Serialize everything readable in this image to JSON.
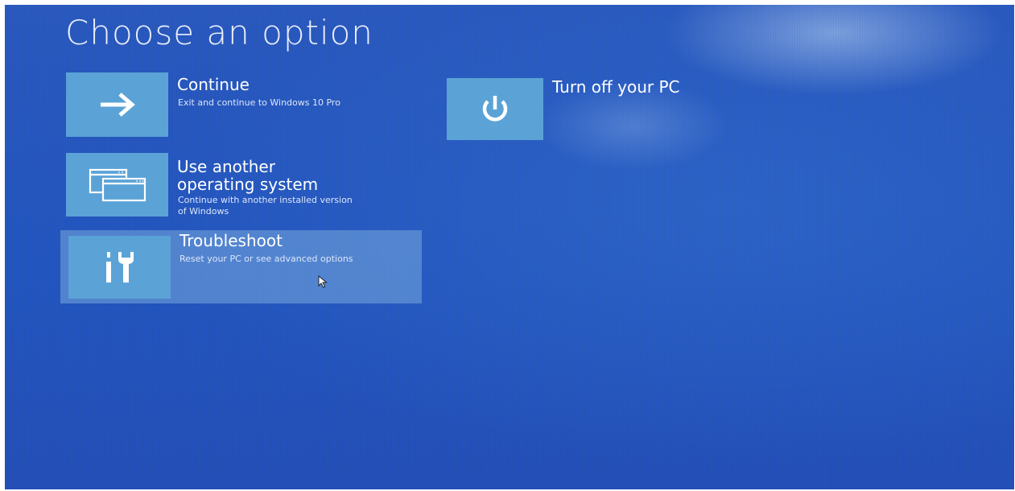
{
  "screen": {
    "title": "Choose an option"
  },
  "options": [
    {
      "title": "Continue",
      "description": "Exit and continue to Windows 10 Pro",
      "icon": "arrow-right-icon"
    },
    {
      "title": "Use another\noperating system",
      "description": "Continue with another installed version\nof Windows",
      "icon": "windows-stack-icon"
    },
    {
      "title": "Troubleshoot",
      "description": "Reset your PC or see advanced options",
      "icon": "tools-icon"
    },
    {
      "title": "Turn off your PC",
      "icon": "power-icon"
    }
  ],
  "colors": {
    "background": "#2356c0",
    "tile": "#5ba3d6",
    "text": "#ffffff"
  }
}
